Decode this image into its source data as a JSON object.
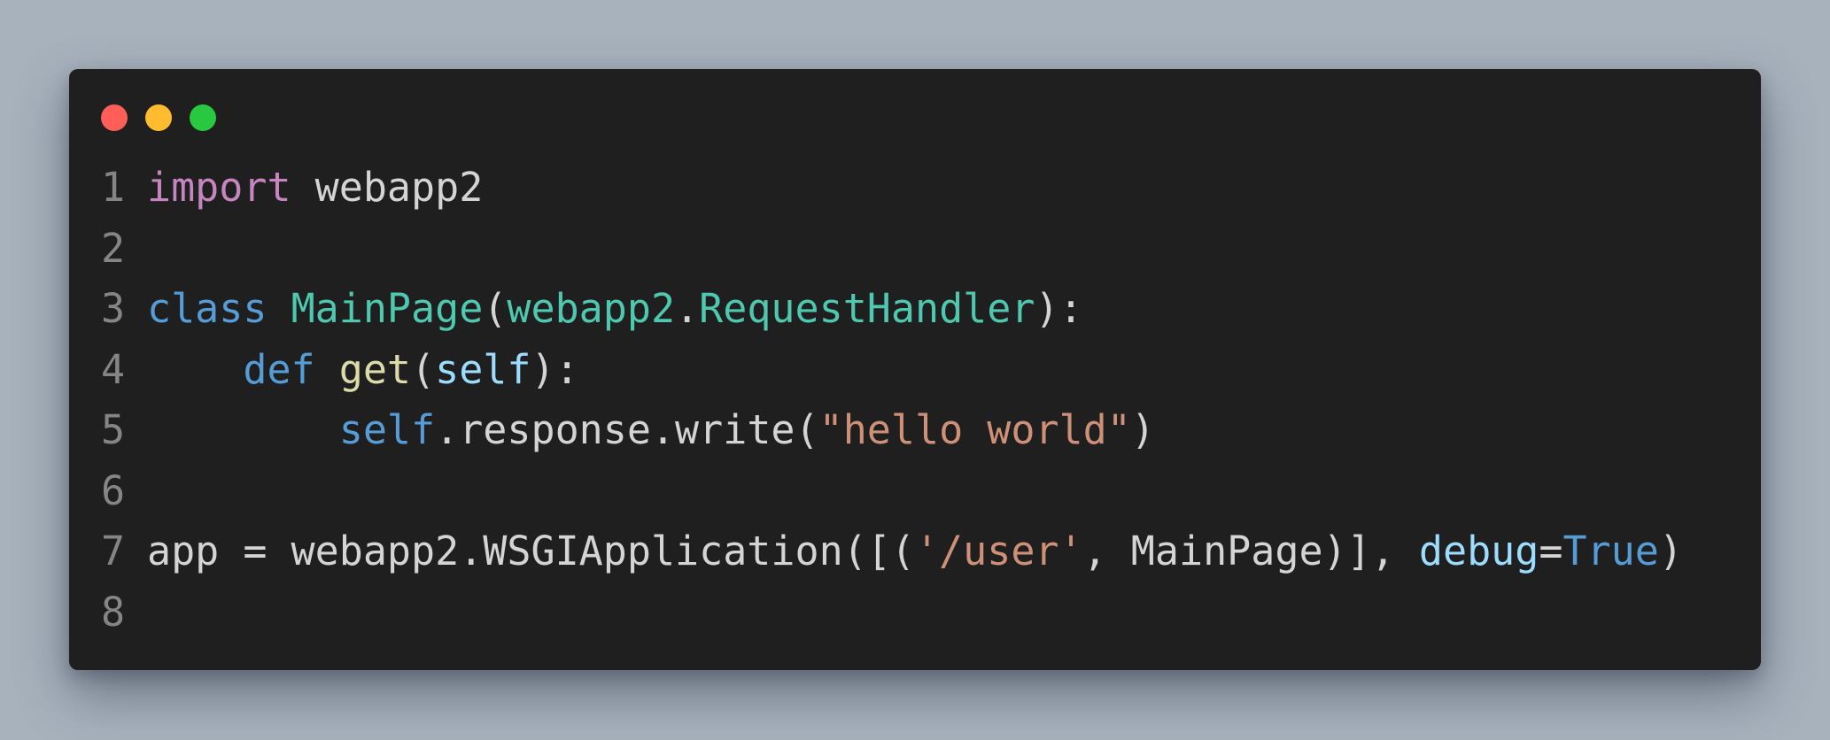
{
  "window": {
    "controls": [
      "close",
      "minimize",
      "maximize"
    ],
    "colors": {
      "close": "#ff5f57",
      "minimize": "#febc2e",
      "maximize": "#28c840",
      "background": "#1f1f1f",
      "page_background": "#a7b2bd"
    }
  },
  "code": {
    "language": "python",
    "lines": [
      {
        "number": "1",
        "tokens": [
          {
            "text": "import",
            "kind": "kw-import"
          },
          {
            "text": " webapp2",
            "kind": "plain"
          }
        ]
      },
      {
        "number": "2",
        "tokens": []
      },
      {
        "number": "3",
        "tokens": [
          {
            "text": "class",
            "kind": "kw-blue"
          },
          {
            "text": " ",
            "kind": "plain"
          },
          {
            "text": "MainPage",
            "kind": "cls"
          },
          {
            "text": "(",
            "kind": "plain"
          },
          {
            "text": "webapp2",
            "kind": "cls"
          },
          {
            "text": ".",
            "kind": "plain"
          },
          {
            "text": "RequestHandler",
            "kind": "cls"
          },
          {
            "text": "):",
            "kind": "plain"
          }
        ]
      },
      {
        "number": "4",
        "tokens": [
          {
            "text": "    ",
            "kind": "plain"
          },
          {
            "text": "def",
            "kind": "kw-blue"
          },
          {
            "text": " ",
            "kind": "plain"
          },
          {
            "text": "get",
            "kind": "fn"
          },
          {
            "text": "(",
            "kind": "plain"
          },
          {
            "text": "self",
            "kind": "param"
          },
          {
            "text": "):",
            "kind": "plain"
          }
        ]
      },
      {
        "number": "5",
        "tokens": [
          {
            "text": "        ",
            "kind": "plain"
          },
          {
            "text": "self",
            "kind": "kw-blue"
          },
          {
            "text": ".response.write(",
            "kind": "plain"
          },
          {
            "text": "\"hello world\"",
            "kind": "str"
          },
          {
            "text": ")",
            "kind": "plain"
          }
        ]
      },
      {
        "number": "6",
        "tokens": []
      },
      {
        "number": "7",
        "tokens": [
          {
            "text": "app = webapp2.WSGIApplication([(",
            "kind": "plain"
          },
          {
            "text": "'/user'",
            "kind": "str"
          },
          {
            "text": ", MainPage)], ",
            "kind": "plain"
          },
          {
            "text": "debug",
            "kind": "param"
          },
          {
            "text": "=",
            "kind": "plain"
          },
          {
            "text": "True",
            "kind": "kw-blue"
          },
          {
            "text": ")",
            "kind": "plain"
          }
        ]
      },
      {
        "number": "8",
        "tokens": []
      }
    ]
  }
}
